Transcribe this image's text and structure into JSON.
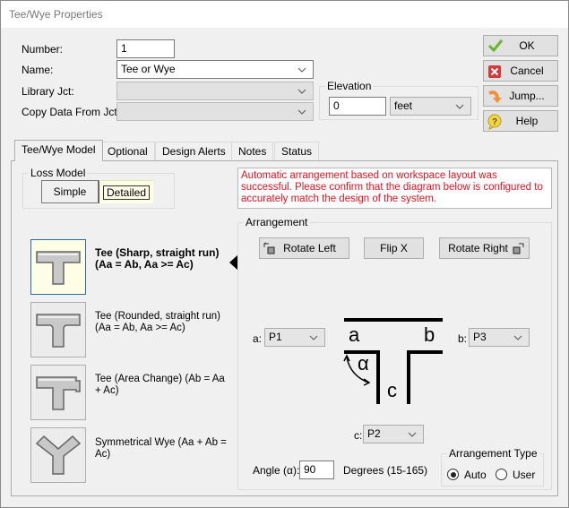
{
  "window": {
    "title": "Tee/Wye Properties"
  },
  "fields": {
    "number": {
      "label": "Number:",
      "value": "1"
    },
    "name": {
      "label": "Name:",
      "value": "Tee or Wye"
    },
    "library": {
      "label": "Library Jct:",
      "value": ""
    },
    "copy_data": {
      "label": "Copy Data From Jct...",
      "value": ""
    }
  },
  "elevation": {
    "title": "Elevation",
    "value": "0",
    "unit": "feet"
  },
  "buttons": {
    "ok": "OK",
    "cancel": "Cancel",
    "jump": "Jump...",
    "help": "Help"
  },
  "tabs": [
    {
      "label": "Tee/Wye Model",
      "active": true
    },
    {
      "label": "Optional"
    },
    {
      "label": "Design Alerts"
    },
    {
      "label": "Notes"
    },
    {
      "label": "Status"
    }
  ],
  "loss_model": {
    "title": "Loss Model",
    "simple": "Simple",
    "detailed": "Detailed",
    "selected": "Detailed"
  },
  "message": "Automatic arrangement based on workspace layout was successful. Please confirm that the diagram below is configured to accurately match the design of the system.",
  "models": [
    {
      "label": "Tee (Sharp, straight run) (Aa = Ab, Aa >= Ac)",
      "selected": true
    },
    {
      "label": "Tee (Rounded, straight run) (Aa = Ab, Aa >= Ac)"
    },
    {
      "label": "Tee (Area Change) (Ab = Aa + Ac)"
    },
    {
      "label": "Symmetrical Wye (Aa + Ab = Ac)"
    }
  ],
  "arrangement": {
    "title": "Arrangement",
    "rotate_left": "Rotate Left",
    "flip_x": "Flip X",
    "rotate_right": "Rotate Right",
    "a_label": "a:",
    "a_value": "P1",
    "b_label": "b:",
    "b_value": "P3",
    "c_label": "c:",
    "c_value": "P2",
    "diagram": {
      "a": "a",
      "b": "b",
      "c": "c",
      "alpha": "α"
    },
    "angle_label": "Angle (α):",
    "angle_value": "90",
    "angle_range": "Degrees (15-165)",
    "type_title": "Arrangement Type",
    "auto": "Auto",
    "user": "User",
    "type_selected": "Auto"
  },
  "colors": {
    "message_text": "#e8101e",
    "selected_tile": "#fefde6"
  }
}
